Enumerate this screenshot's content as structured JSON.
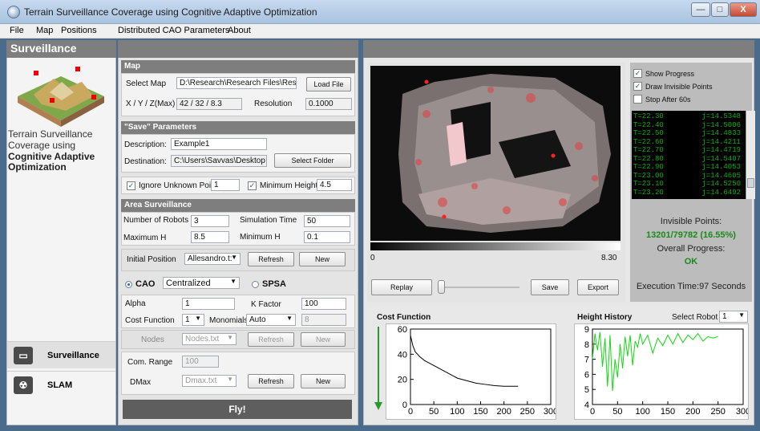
{
  "window": {
    "title": "Terrain Surveillance Coverage using Cognitive Adaptive Optimization",
    "minimize": "—",
    "maximize": "□",
    "close": "X"
  },
  "menu": [
    "File",
    "Map",
    "Positions",
    "Distributed CAO Parameters",
    "About"
  ],
  "left": {
    "header": "Surveillance",
    "caption": "Terrain Surveillance Coverage using",
    "caption_bold": "Cognitive Adaptive Optimization",
    "nav": [
      {
        "label": "Surveillance",
        "icon": "monitor-icon"
      },
      {
        "label": "SLAM",
        "icon": "radiation-icon"
      }
    ]
  },
  "map_section": {
    "title": "Map",
    "select_map_label": "Select Map",
    "select_map_value": "D:\\Research\\Research Files\\Resea",
    "load_file": "Load File",
    "xyz_label": "X / Y / Z(Max)",
    "xyz_value": "42 / 32 / 8.3",
    "resolution_label": "Resolution",
    "resolution_value": "0.1000"
  },
  "save_section": {
    "title": "\"Save\" Parameters",
    "description_label": "Description:",
    "description_value": "Example1",
    "destination_label": "Destination:",
    "destination_value": "C:\\Users\\Savvas\\Desktop",
    "select_folder": "Select Folder"
  },
  "ignore": {
    "ignore_label": "Ignore Unknown Points",
    "ignore_value": "1",
    "ignore_checked": true,
    "minheight_label": "Minimum Height",
    "minheight_value": "4.5",
    "minheight_checked": true
  },
  "area": {
    "title": "Area Surveillance",
    "num_robots_label": "Number of Robots",
    "num_robots": "3",
    "sim_time_label": "Simulation Time",
    "sim_time": "50",
    "max_h_label": "Maximum H",
    "max_h": "8.5",
    "min_h_label": "Minimum H",
    "min_h": "0.1",
    "init_pos_label": "Initial Position",
    "init_pos": "Allesandro.t:",
    "refresh": "Refresh",
    "new": "New"
  },
  "algo": {
    "cao_label": "CAO",
    "mode": "Centralized",
    "spsa_label": "SPSA",
    "alpha_label": "Alpha",
    "alpha": "1",
    "kfactor_label": "K Factor",
    "kfactor": "100",
    "cost_fn_label": "Cost Function",
    "cost_fn": "1",
    "monomials_label": "Monomials",
    "monomials": "Auto",
    "monomials_num": "8",
    "nodes_label": "Nodes",
    "nodes_file": "Nodes.txt",
    "comrange_label": "Com. Range",
    "comrange": "100",
    "dmax_label": "DMax",
    "dmax_file": "Dmax.txt"
  },
  "fly": "Fly!",
  "viewer": {
    "scale_min": "0",
    "scale_max": "8.30",
    "replay": "Replay",
    "save": "Save",
    "export": "Export"
  },
  "options": {
    "show_progress": "Show Progress",
    "draw_invisible": "Draw Invisible Points",
    "stop_after": "Stop After 60s",
    "show_checked": true,
    "draw_checked": true,
    "stop_checked": false
  },
  "log": [
    [
      "T=22.30",
      "j=14.5348"
    ],
    [
      "T=22.40",
      "j=14.5006"
    ],
    [
      "T=22.50",
      "j=14.4833"
    ],
    [
      "T=22.60",
      "j=14.4211"
    ],
    [
      "T=22.70",
      "j=14.4719"
    ],
    [
      "T=22.80",
      "j=14.5407"
    ],
    [
      "T=22.90",
      "j=14.4053"
    ],
    [
      "T=23.00",
      "j=14.4605"
    ],
    [
      "T=23.10",
      "j=14.5250"
    ],
    [
      "T=23.20",
      "j=14.6492"
    ]
  ],
  "status": {
    "invisible_label": "Invisible Points:",
    "invisible_value": "13201/79782 (16.55%)",
    "overall_label": "Overall Progress:",
    "overall_value": "OK",
    "exec_time": "Execution Time:97 Seconds"
  },
  "charts": {
    "cost_title": "Cost Function",
    "height_title": "Height History",
    "select_robot_label": "Select Robot",
    "select_robot": "1"
  },
  "chart_data": [
    {
      "type": "line",
      "title": "Cost Function",
      "xlim": [
        0,
        300
      ],
      "ylim": [
        0,
        60
      ],
      "xticks": [
        0,
        50,
        100,
        150,
        200,
        250,
        300
      ],
      "yticks": [
        0,
        20,
        40,
        60
      ],
      "series": [
        {
          "x": [
            0,
            5,
            10,
            15,
            20,
            30,
            40,
            50,
            60,
            70,
            80,
            90,
            100,
            120,
            140,
            160,
            180,
            200,
            220,
            230
          ],
          "y": [
            55,
            47,
            42,
            40,
            38,
            35,
            33,
            31,
            29,
            27,
            25,
            23,
            21,
            19,
            17,
            16,
            15,
            14.5,
            14.5,
            14.5
          ]
        }
      ]
    },
    {
      "type": "line",
      "title": "Height History",
      "xlim": [
        0,
        300
      ],
      "ylim": [
        4,
        9
      ],
      "xticks": [
        0,
        50,
        100,
        150,
        200,
        250,
        300
      ],
      "yticks": [
        4,
        5,
        6,
        7,
        8,
        9
      ],
      "series": [
        {
          "x": [
            0,
            5,
            10,
            15,
            20,
            25,
            30,
            35,
            40,
            45,
            50,
            55,
            60,
            65,
            70,
            75,
            80,
            85,
            90,
            95,
            100,
            110,
            120,
            130,
            140,
            150,
            160,
            170,
            180,
            190,
            200,
            210,
            220,
            230,
            240,
            250
          ],
          "y": [
            7,
            8.7,
            7.6,
            8.8,
            6.5,
            8.4,
            5.2,
            8.6,
            4.9,
            7,
            5.8,
            8,
            6.4,
            8.5,
            7.2,
            8.6,
            6.6,
            8.2,
            7.8,
            8.7,
            8,
            8.6,
            7.4,
            8.4,
            7.9,
            8.6,
            8,
            8.7,
            8.1,
            8.6,
            8.3,
            8.7,
            8.2,
            8.5,
            8.4,
            8.5
          ]
        }
      ]
    }
  ]
}
